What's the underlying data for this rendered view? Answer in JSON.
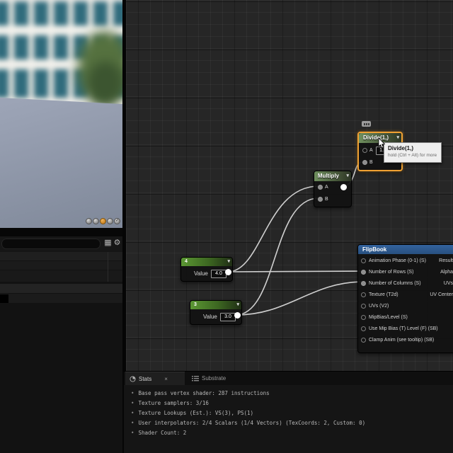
{
  "left_panel": {
    "viewport": {
      "shape_buttons": [
        {
          "name": "cylinder"
        },
        {
          "name": "sphere"
        },
        {
          "name": "plane",
          "active": true
        },
        {
          "name": "cube"
        },
        {
          "name": "custom-mesh"
        }
      ]
    },
    "search": {
      "placeholder": ""
    }
  },
  "graph": {
    "nodes": {
      "divide": {
        "title": "Divide(1,)",
        "pin_a": "A",
        "pin_a_value": "1.0",
        "pin_b": "B"
      },
      "multiply": {
        "title": "Multiply",
        "pin_a": "A",
        "pin_b": "B"
      },
      "const4": {
        "header": "4",
        "value_label": "Value",
        "value": "4.0"
      },
      "const3": {
        "header": "3",
        "value_label": "Value",
        "value": "3.0"
      },
      "flipbook": {
        "title": "FlipBook",
        "inputs": [
          {
            "label": "Animation Phase (0-1) (S)"
          },
          {
            "label": "Number of Rows (S)"
          },
          {
            "label": "Number of Columns (S)"
          },
          {
            "label": "Texture (T2d)"
          },
          {
            "label": "UVs (V2)"
          },
          {
            "label": "MipBias/Level (S)"
          },
          {
            "label": "Use Mip Bias (T) Level (F) (SB)"
          },
          {
            "label": "Clamp Anim (see tooltip) (SB)"
          }
        ],
        "outputs": [
          {
            "label": "Result"
          },
          {
            "label": "Alpha"
          },
          {
            "label": "UVs"
          },
          {
            "label": "UV Center"
          }
        ]
      }
    },
    "tooltip": {
      "title": "Divide(1,)",
      "subtitle": "hold (Ctrl + Alt) for more"
    }
  },
  "stats_panel": {
    "tabs": [
      {
        "label": "Stats"
      },
      {
        "label": "Substrate"
      }
    ],
    "lines": [
      "Base pass vertex shader: 287 instructions",
      "Texture samplers: 3/16",
      "Texture Lookups (Est.): VS(3), PS(1)",
      "User interpolators: 2/4 Scalars (1/4 Vectors) (TexCoords: 2, Custom: 0)",
      "Shader Count: 2"
    ]
  },
  "icons": {
    "chevron_down": "▾",
    "close": "×",
    "gear": "⚙",
    "grid_view": "▦",
    "bullet": "•"
  },
  "colors": {
    "selection_orange": "#f0a132",
    "wire": "#d9d9d9",
    "math_header_green": "#6f8f5e",
    "const_header_green": "#5b9733",
    "flipbook_header_blue": "#2d5a92",
    "graph_bg": "#262626"
  }
}
